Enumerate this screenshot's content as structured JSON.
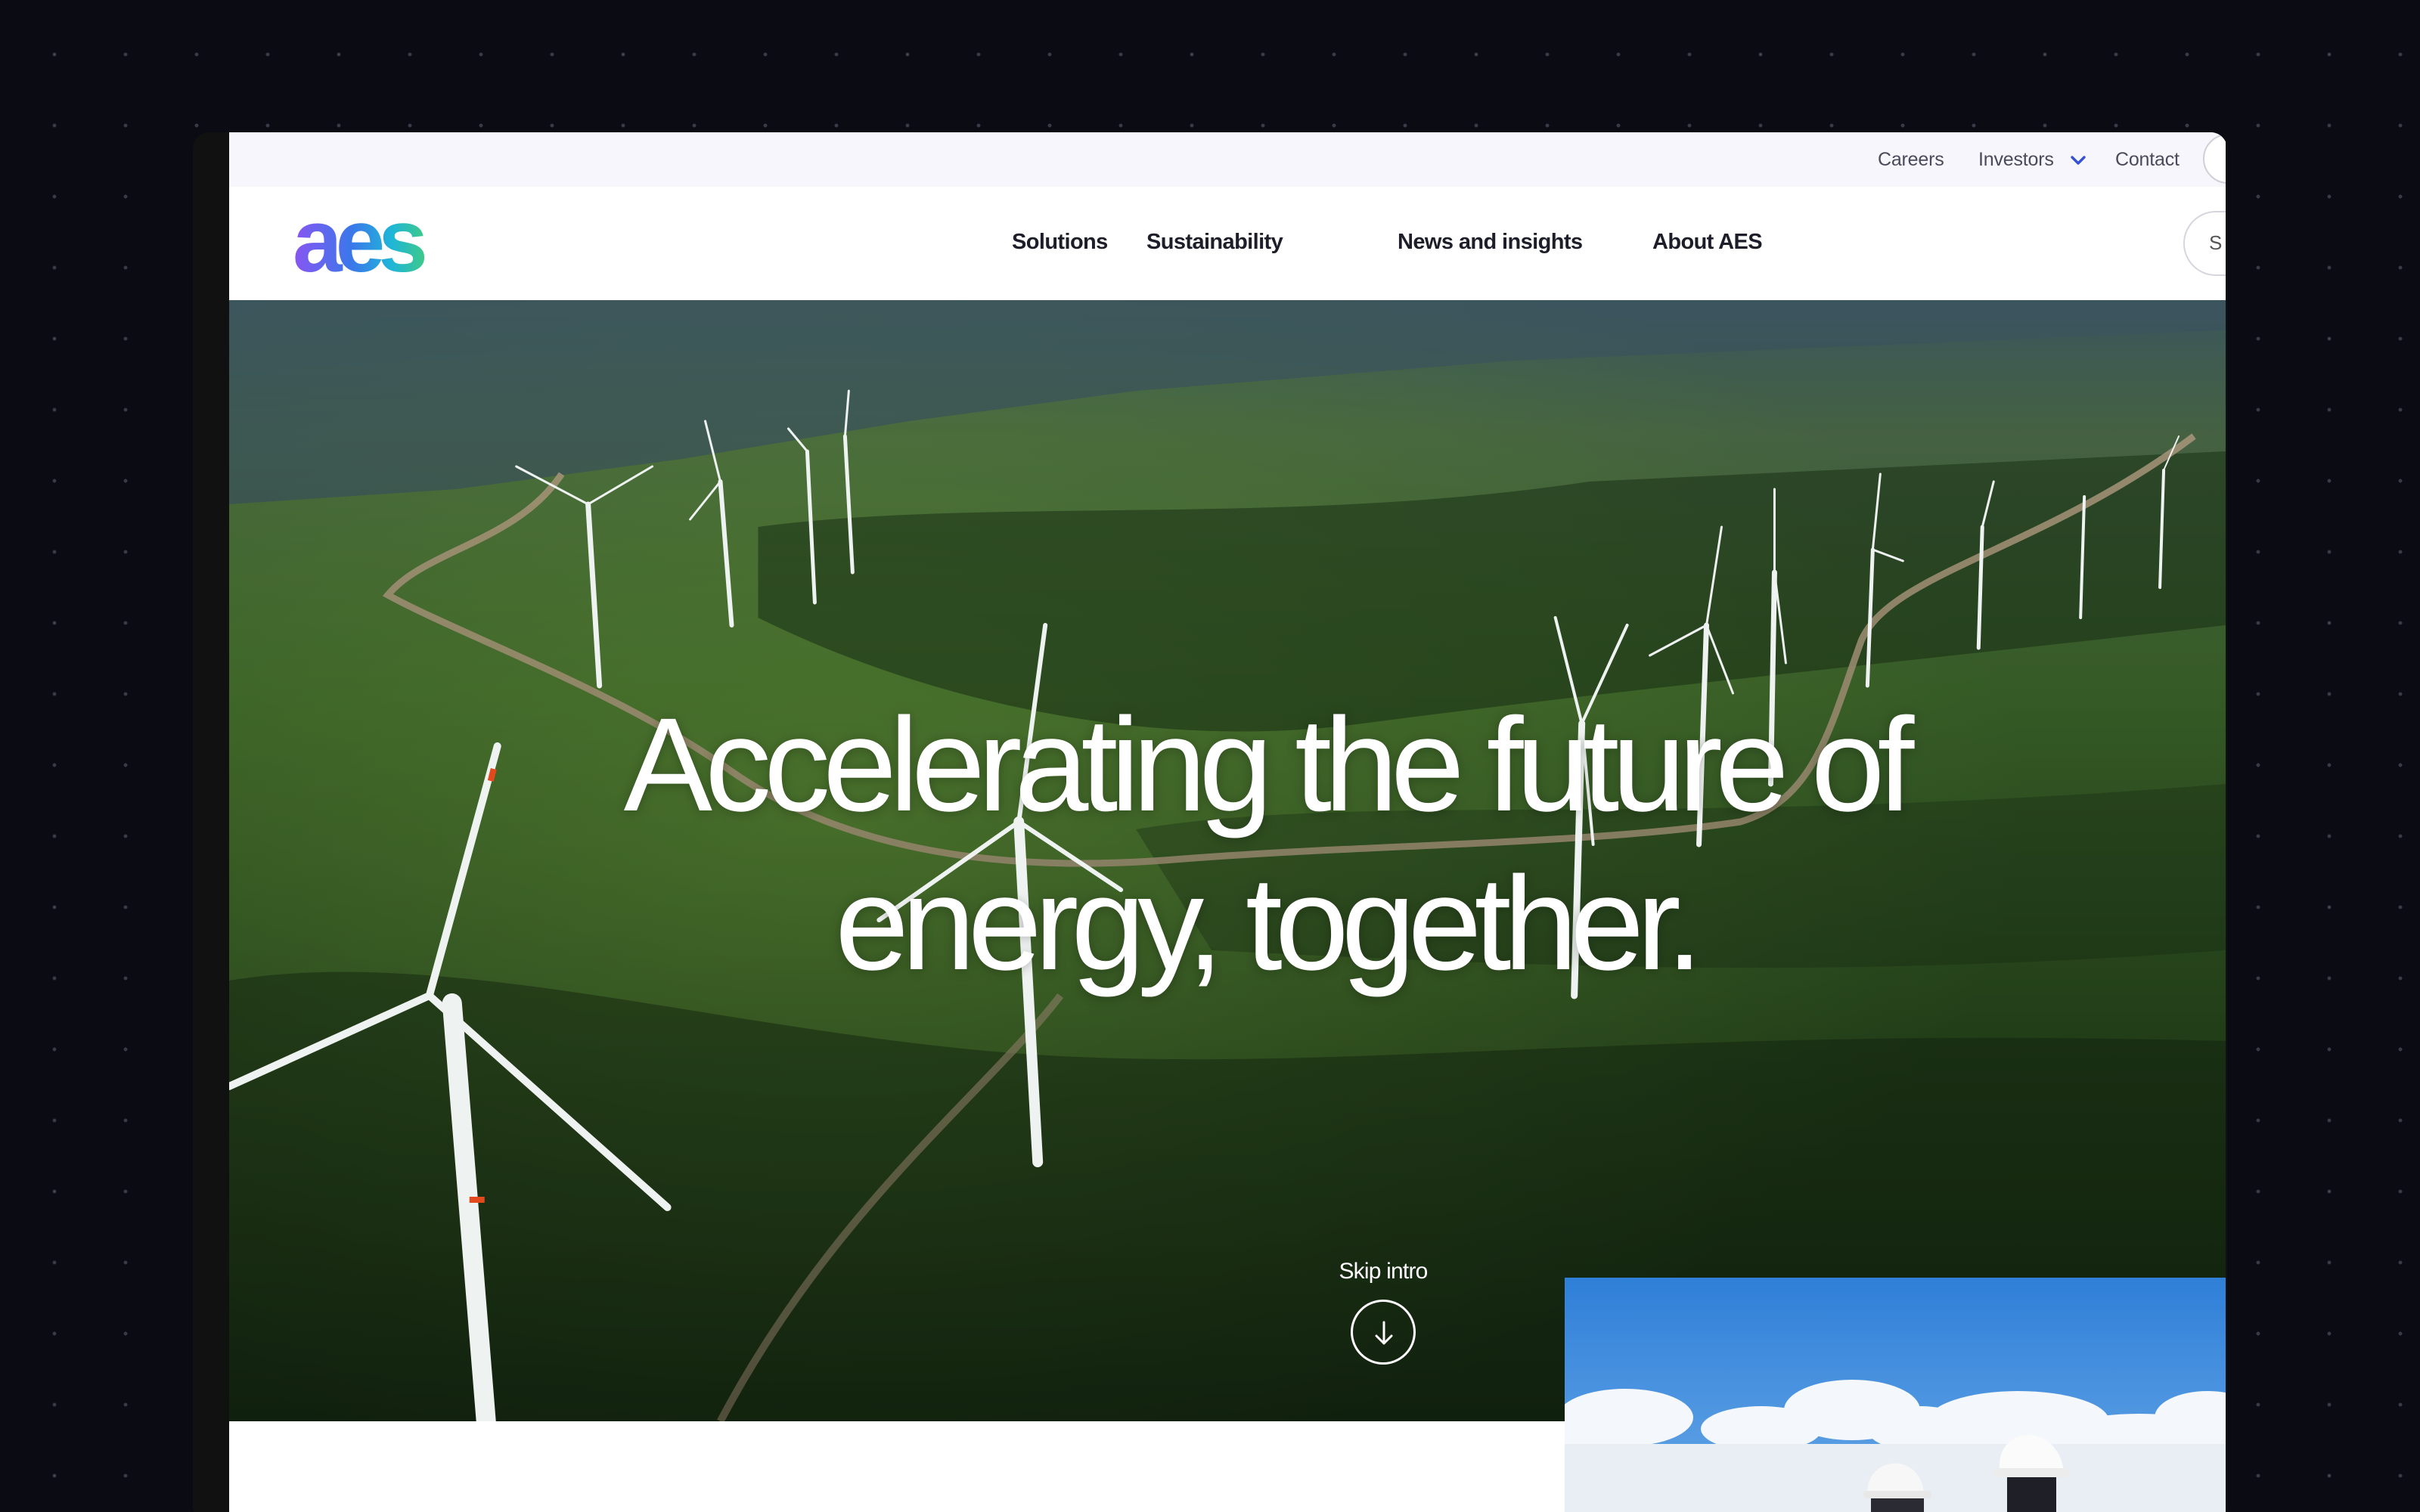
{
  "utility_nav": {
    "links": [
      {
        "label": "Careers"
      },
      {
        "label": "Investors",
        "icon": "chevron-down-icon"
      },
      {
        "label": "Contact"
      }
    ]
  },
  "brand": {
    "logo_text": "aes",
    "colors": {
      "purple": "#7a5cf0",
      "blue": "#2d7be8",
      "teal": "#22c4a4",
      "green": "#45c27a"
    }
  },
  "main_nav": {
    "items": [
      {
        "label": "Solutions"
      },
      {
        "label": "Sustainability"
      },
      {
        "label": "News and insights"
      },
      {
        "label": "About AES"
      }
    ],
    "search_icon": "search-icon",
    "search_label": "S"
  },
  "hero": {
    "headline": "Accelerating the future of energy, together.",
    "skip_label": "Skip intro",
    "skip_icon": "arrow-down-icon"
  },
  "colors": {
    "page_background": "#0b0b13",
    "utility_bar": "#f6f6fc",
    "nav_text": "#1e1e2a",
    "hero_green": "#2f5a24"
  }
}
